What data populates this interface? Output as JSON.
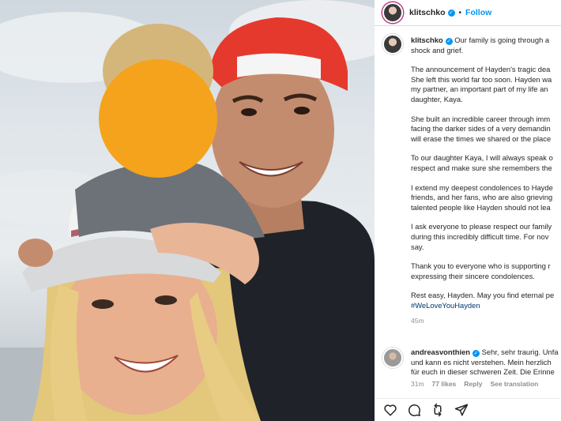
{
  "post": {
    "username": "klitschko",
    "follow_label": "Follow",
    "dot": "•",
    "caption_lines": [
      "Our family is going through a",
      "shock and grief."
    ],
    "paragraphs": [
      [
        "The announcement of Hayden's tragic dea",
        "She left this world far too soon. Hayden wa",
        "my partner, an important part of my life an",
        "daughter, Kaya."
      ],
      [
        "She built an incredible career through imm",
        "facing the darker sides of a very demandin",
        "will erase the times we shared or the place"
      ],
      [
        "To our daughter Kaya, I will always speak o",
        "respect and make sure she remembers the"
      ],
      [
        "I extend my deepest condolences to Hayde",
        "friends, and her fans, who are also grieving",
        "talented people like Hayden should not lea"
      ],
      [
        "I ask everyone to please respect our family",
        "during this incredibly difficult time. For nov",
        "say."
      ],
      [
        "Thank you to everyone who is supporting r",
        "expressing their sincere condolences."
      ],
      [
        "Rest easy, Hayden. May you find eternal pe"
      ]
    ],
    "hashtag": "#WeLoveYouHayden",
    "time": "45m"
  },
  "comment": {
    "username": "andreasvonthien",
    "lines": [
      "Sehr, sehr traurig. Unfa",
      "und kann es nicht verstehen. Mein herzlich",
      "für euch in dieser schweren Zeit. Die Erinne"
    ],
    "time": "31m",
    "likes": "77 likes",
    "reply": "Reply",
    "translate": "See translation"
  },
  "actions": {
    "icons": [
      "heart-icon",
      "comment-icon",
      "share-icon",
      "send-icon"
    ]
  },
  "colors": {
    "accent": "#0095f6",
    "text": "#262626",
    "muted": "#8e8e8e",
    "blur_patch": "#f5a31c"
  }
}
